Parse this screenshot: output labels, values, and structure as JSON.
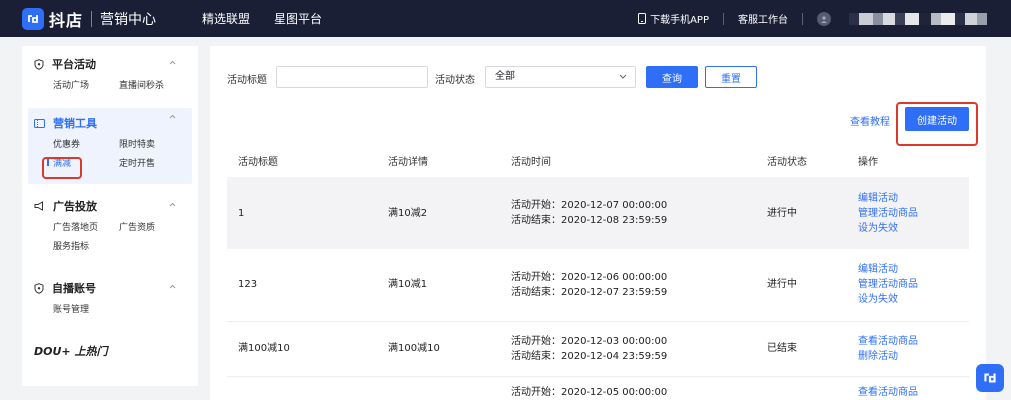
{
  "topbar": {
    "brand": "抖店",
    "subtitle": "营销中心",
    "nav": [
      "精选联盟",
      "星图平台"
    ],
    "download_app": "下载手机APP",
    "customer_service": "客服工作台"
  },
  "sidebar": {
    "sections": [
      {
        "title": "平台活动",
        "items": [
          "活动广场",
          "直播间秒杀"
        ]
      },
      {
        "title": "营销工具",
        "items": [
          "优惠券",
          "限时特卖",
          "满减",
          "定时开售"
        ],
        "active_item": "满减"
      },
      {
        "title": "广告投放",
        "items": [
          "广告落地页",
          "广告资质",
          "服务指标"
        ]
      },
      {
        "title": "自播账号",
        "items": [
          "账号管理"
        ]
      }
    ],
    "dou_plus": "DOU+ 上热门"
  },
  "filters": {
    "title_label": "活动标题",
    "title_value": "",
    "status_label": "活动状态",
    "status_value": "全部",
    "search_button": "查询",
    "reset_button": "重置"
  },
  "actions": {
    "tutorial_link": "查看教程",
    "create_button": "创建活动"
  },
  "table": {
    "headers": [
      "活动标题",
      "活动详情",
      "活动时间",
      "活动状态",
      "操作"
    ],
    "rows": [
      {
        "title": "1",
        "detail": "满10减2",
        "start": "活动开始：2020-12-07 00:00:00",
        "end": "活动结束：2020-12-08 23:59:59",
        "status": "进行中",
        "ops": [
          "编辑活动",
          "管理活动商品",
          "设为失效"
        ]
      },
      {
        "title": "123",
        "detail": "满10减1",
        "start": "活动开始：2020-12-06 00:00:00",
        "end": "活动结束：2020-12-07 23:59:59",
        "status": "进行中",
        "ops": [
          "编辑活动",
          "管理活动商品",
          "设为失效"
        ]
      },
      {
        "title": "满100减10",
        "detail": "满100减10",
        "start": "活动开始：2020-12-03 00:00:00",
        "end": "活动结束：2020-12-04 23:59:59",
        "status": "已结束",
        "ops": [
          "查看活动商品",
          "删除活动"
        ]
      },
      {
        "title": "",
        "detail": "",
        "start": "活动开始：2020-12-05 00:00:00",
        "end": "",
        "status": "",
        "ops": [
          "查看活动商品"
        ]
      }
    ]
  },
  "colors": {
    "accent": "#2f6ff7",
    "topbar": "#1a1f36",
    "highlight_box": "#d93a2b"
  }
}
